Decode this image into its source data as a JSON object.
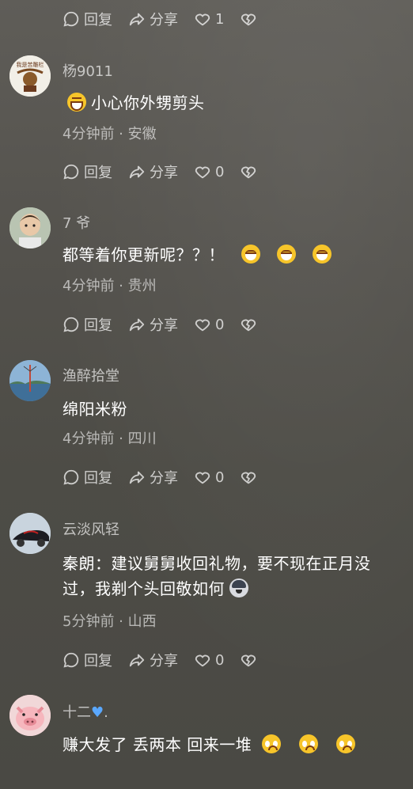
{
  "actions": {
    "reply": "回复",
    "share": "分享"
  },
  "top_actions": {
    "like_count": "1"
  },
  "comments": [
    {
      "user": "杨9011",
      "text": "小心你外甥剪头",
      "meta": "4分钟前 · 安徽",
      "likes": "0",
      "emoji": [
        "grin"
      ]
    },
    {
      "user": "7 爷",
      "text": "都等着你更新呢？？！",
      "meta": "4分钟前 · 贵州",
      "likes": "0",
      "emoji": [
        "laugh",
        "laugh",
        "laugh"
      ]
    },
    {
      "user": "渔醉拾堂",
      "text": "绵阳米粉",
      "meta": "4分钟前 · 四川",
      "likes": "0"
    },
    {
      "user": "云淡风轻",
      "text_line1": "秦朗：建议舅舅收回礼物，要不现在正月没",
      "text_line2": "过，我剃个头回敬如何",
      "meta": "5分钟前 · 山西",
      "likes": "0",
      "emoji": [
        "dog"
      ]
    },
    {
      "user": "十二",
      "user_suffix": ".",
      "text": "赚大发了 丢两本 回来一堆",
      "emoji": [
        "cry",
        "cry",
        "cry"
      ]
    }
  ],
  "avatar_text": {
    "c0": "我是苦雕栏"
  },
  "colors": {
    "background": "#55534e",
    "muted": "#b8b6b0",
    "blue_heart": "#5aa8ff",
    "emoji": "#f7c52a"
  }
}
